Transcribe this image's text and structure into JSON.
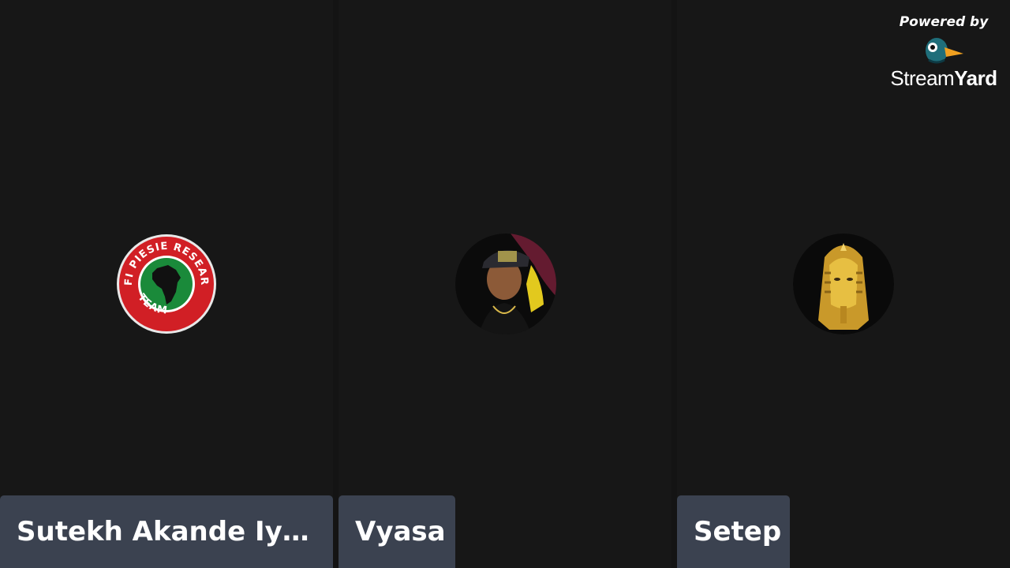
{
  "participants": [
    {
      "name": "Sutekh Akande Iya...",
      "avatar": "kofi-piesie-research-team-logo",
      "avatar_text": "KOFI PIESIE RESEARCH TEAM"
    },
    {
      "name": "Vyasa",
      "avatar": "person-photo"
    },
    {
      "name": "Setep",
      "avatar": "golden-pharaoh-mask"
    }
  ],
  "branding": {
    "powered_by": "Powered by",
    "logo_word_1": "Stream",
    "logo_word_2": "Yard"
  },
  "colors": {
    "background": "#141414",
    "tile": "#171717",
    "name_tag": "#3b4250"
  }
}
